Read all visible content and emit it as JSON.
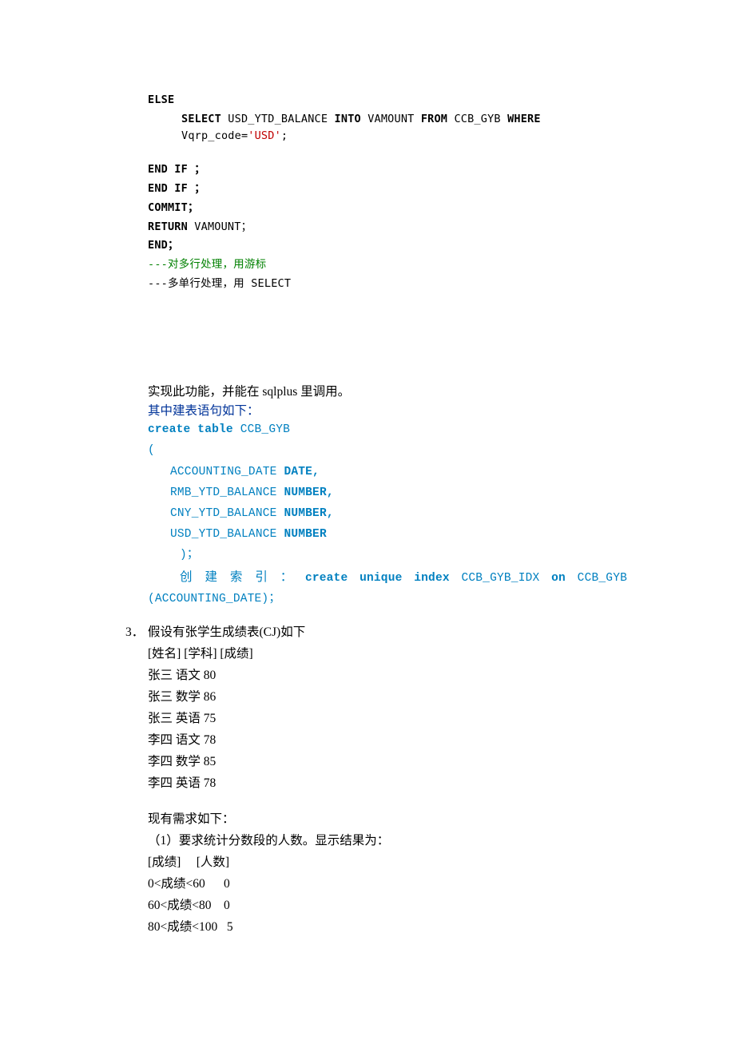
{
  "code1": {
    "l1": "ELSE",
    "l2a": "SELECT ",
    "l2b": "USD_YTD_BALANCE  ",
    "l2c": "INTO ",
    "l2d": " VAMOUNT   ",
    "l2e": "FROM ",
    "l2f": "CCB_GYB  ",
    "l2g": "WHERE ",
    "l2h": "Vqrp_code=",
    "l2i": "'USD'",
    "l2j": ";",
    "l3": "END IF ；",
    "l4": "END  IF ；",
    "l5": "COMMIT；",
    "l6a": "RETURN  ",
    "l6b": "VAMOUNT；",
    "l7": "END；",
    "l8": "---对多行处理，用游标",
    "l9": "---多单行处理，用 SELECT"
  },
  "p1": " 实现此功能，并能在 sqlplus 里调用。",
  "p2": "其中建表语句如下：",
  "ddl": {
    "l1a": " create table ",
    "l1b": "CCB_GYB",
    "l2": " (",
    "l3a": "ACCOUNTING_DATE ",
    "l3b": "DATE,",
    "l4a": "RMB_YTD_BALANCE ",
    "l4b": "NUMBER,",
    "l5a": "CNY_YTD_BALANCE ",
    "l5b": "NUMBER,",
    "l6a": "USD_YTD_BALANCE ",
    "l6b": "NUMBER",
    "l7": ")；",
    "idx_a": "创 建 索 引 ：",
    "idx_b": "create  unique  index",
    "idx_c": "  CCB_GYB_IDX  ",
    "idx_d": "on",
    "idx_e": "  CCB_GYB",
    "idx_f": "(ACCOUNTING_DATE)；"
  },
  "q3num": "3．",
  "q3": {
    "l1": "假设有张学生成绩表(CJ)如下",
    "l2": "[姓名] [学科] [成绩]",
    "l3": "张三 语文 80",
    "l4": "张三 数学 86",
    "l5": "张三 英语 75",
    "l6": "李四 语文 78",
    "l7": "李四 数学 85",
    "l8": "李四 英语 78",
    "l9": "现有需求如下：",
    "l10": "（1）要求统计分数段的人数。显示结果为：",
    "l11": "[成绩]     [人数]",
    "l12": "0<成绩<60      0",
    "l13": "60<成绩<80    0",
    "l14": "80<成绩<100   5"
  }
}
